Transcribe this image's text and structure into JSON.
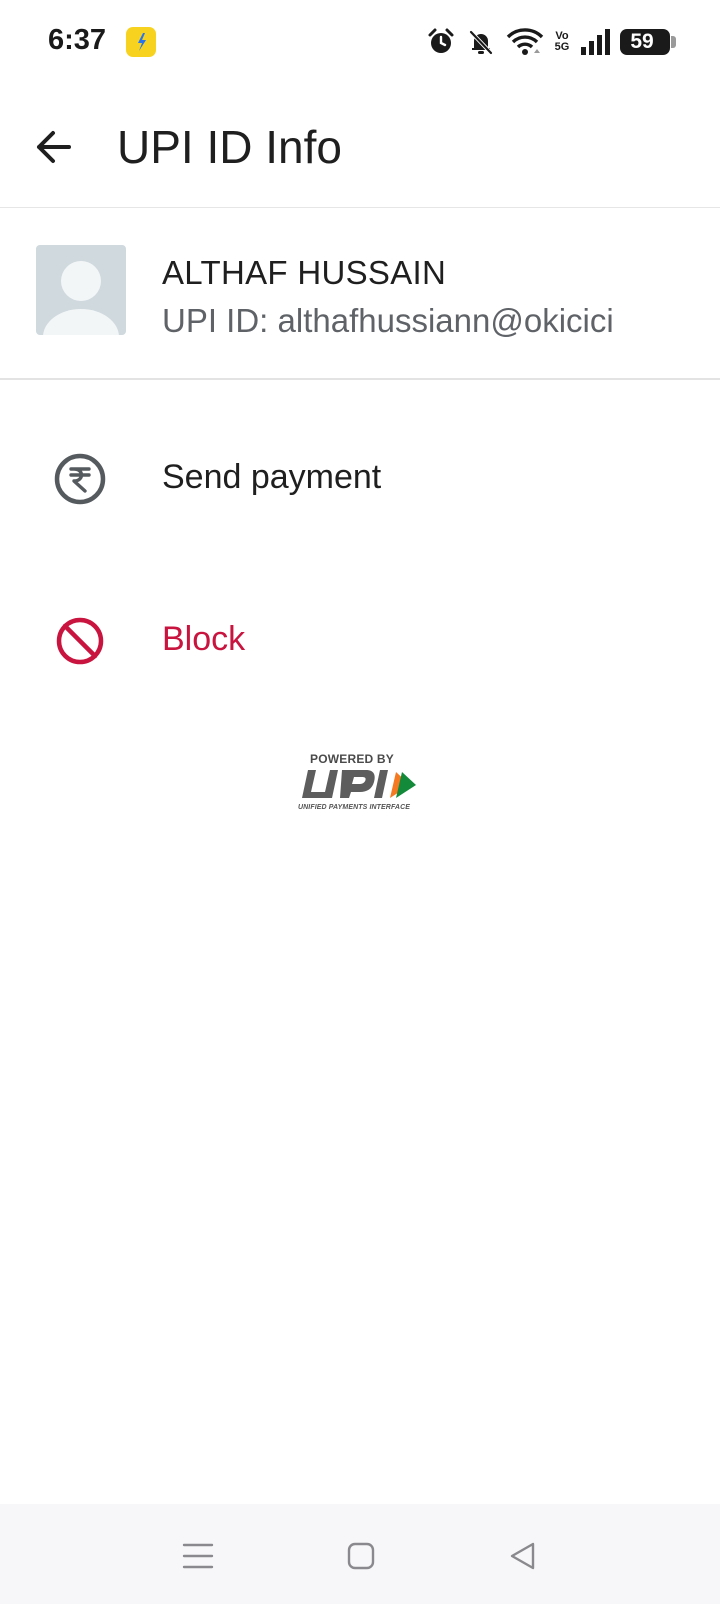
{
  "status_bar": {
    "time": "6:37",
    "battery": "59",
    "network_tag": "Vo 5G",
    "icons": [
      "flipkart-icon",
      "alarm-icon",
      "bell-off-icon",
      "wifi-icon",
      "signal-icon",
      "battery-icon"
    ]
  },
  "app_bar": {
    "title": "UPI ID Info",
    "back_icon": "arrow-left-icon"
  },
  "contact": {
    "name": "ALTHAF HUSSAIN",
    "upi_id": "UPI ID: althafhussiann@okicici"
  },
  "actions": {
    "send_payment": "Send payment",
    "block": "Block"
  },
  "upi_logo": {
    "powered_by": "POWERED BY",
    "subtitle": "UNIFIED PAYMENTS INTERFACE"
  },
  "colors": {
    "block_red": "#c8143e",
    "icon_grey": "#555a5f",
    "upi_orange": "#f47920",
    "upi_green": "#128a3a"
  }
}
